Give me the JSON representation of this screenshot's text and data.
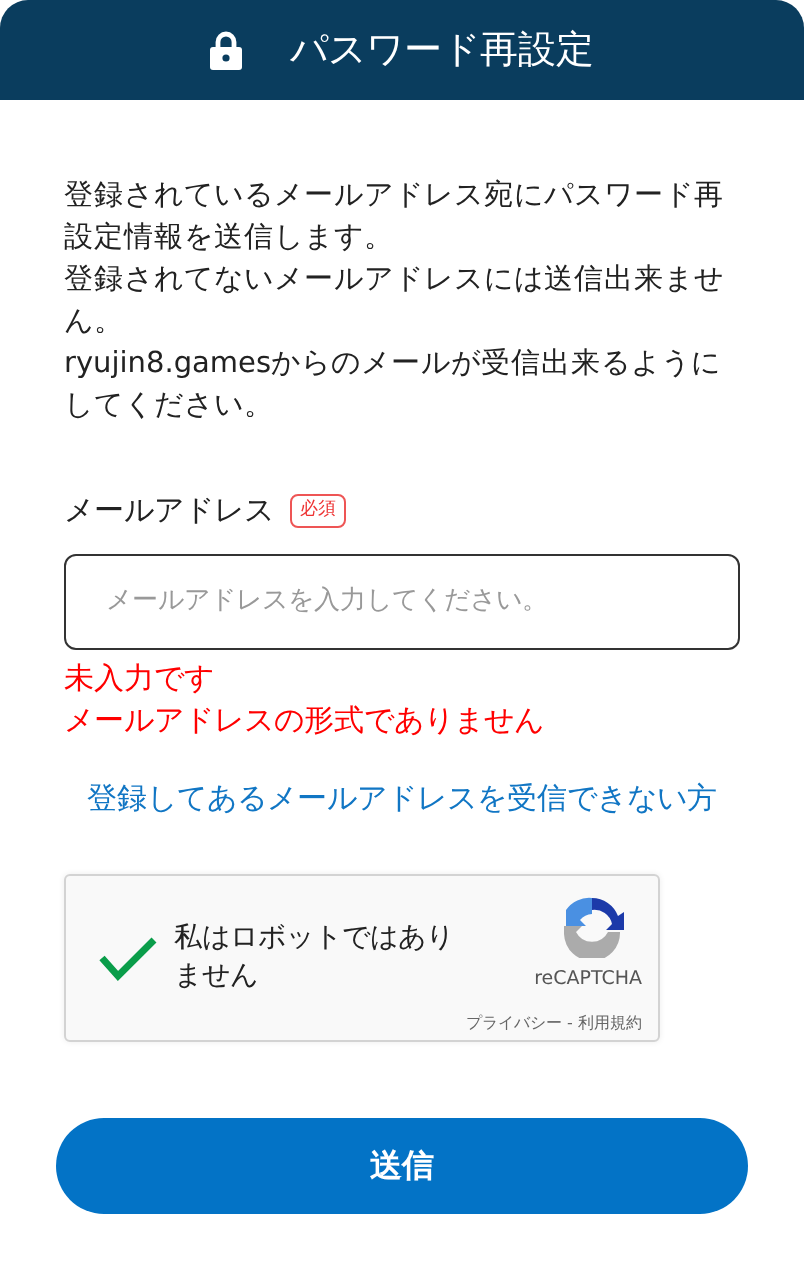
{
  "header": {
    "title": "パスワード再設定"
  },
  "description": [
    "登録されているメールアドレス宛にパスワード再設定情報を送信します。",
    "登録されてないメールアドレスには送信出来ません。",
    "ryujin8.gamesからのメールが受信出来るようにしてください。"
  ],
  "email_field": {
    "label": "メールアドレス",
    "required_badge": "必須",
    "placeholder": "メールアドレスを入力してください。"
  },
  "errors": [
    "未入力です",
    "メールアドレスの形式でありません"
  ],
  "help_link": "登録してあるメールアドレスを受信できない方",
  "captcha": {
    "checked": true,
    "label": "私はロボットではありません",
    "brand": "reCAPTCHA",
    "footer": "プライバシー - 利用規約"
  },
  "submit_button": "送信"
}
